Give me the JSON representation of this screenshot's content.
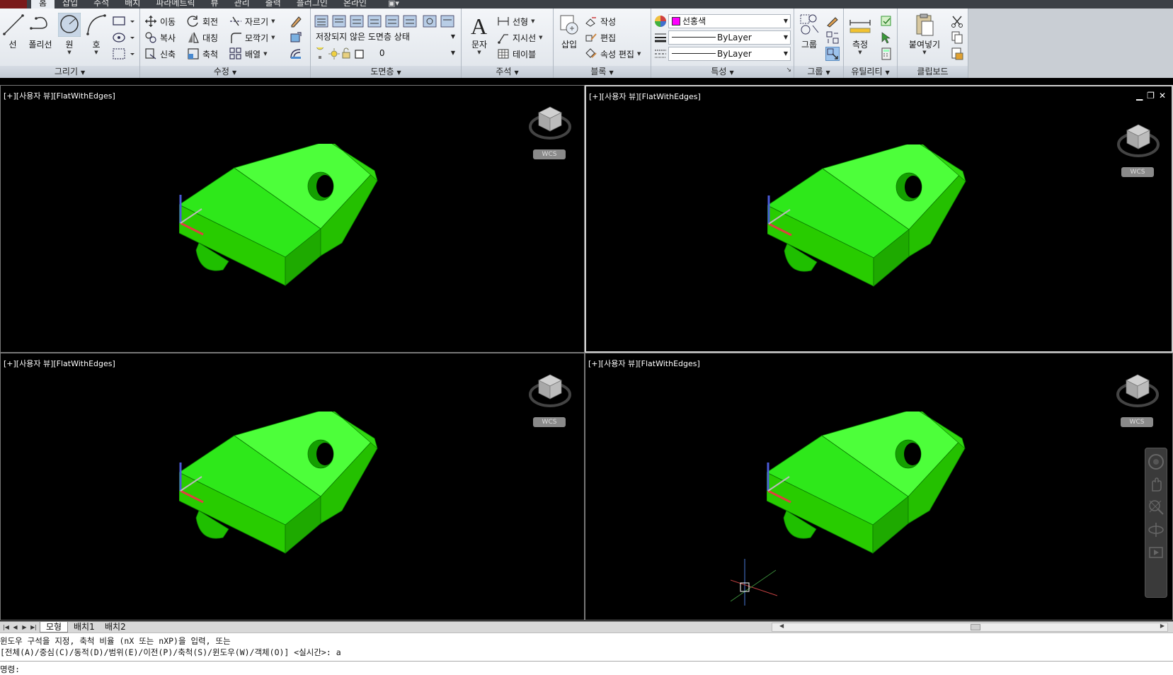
{
  "menu": {
    "tabs": [
      "홈",
      "삽입",
      "주석",
      "배치",
      "파라메트릭",
      "뷰",
      "관리",
      "출력",
      "플러그인",
      "온라인"
    ],
    "active_tab": "홈"
  },
  "ribbon": {
    "draw": {
      "footer": "그리기",
      "line": "선",
      "polyline": "폴리선",
      "circle": "원",
      "arc": "호"
    },
    "modify": {
      "footer": "수정",
      "move": "이동",
      "rotate": "회전",
      "trim": "자르기",
      "copy": "복사",
      "mirror": "대칭",
      "fillet": "모깍기",
      "stretch": "신축",
      "scale": "축척",
      "array": "배열"
    },
    "layers": {
      "footer": "도면층",
      "state": "저장되지 않은 도면층 상태",
      "current_layer": "0"
    },
    "annotation": {
      "footer": "주석",
      "text": "문자",
      "linear": "선형",
      "leader": "지시선",
      "table": "테이블"
    },
    "block": {
      "footer": "블록",
      "insert": "삽입",
      "create": "작성",
      "edit": "편집",
      "edit_attributes": "속성 편집"
    },
    "properties": {
      "footer": "특성",
      "color": "선홍색",
      "color_hex": "#ff00ff",
      "lineweight": "ByLayer",
      "linetype": "ByLayer"
    },
    "groups": {
      "footer": "그룹",
      "group": "그룹"
    },
    "utilities": {
      "footer": "유틸리티",
      "measure": "측정"
    },
    "clipboard": {
      "footer": "클립보드",
      "paste": "붙여넣기"
    }
  },
  "viewports": [
    {
      "label": "[+][사용자 뷰][FlatWithEdges]",
      "wcs": "WCS",
      "active": false
    },
    {
      "label": "[+][사용자 뷰][FlatWithEdges]",
      "wcs": "WCS",
      "active": true
    },
    {
      "label": "[+][사용자 뷰][FlatWithEdges]",
      "wcs": "WCS",
      "active": false
    },
    {
      "label": "[+][사용자 뷰][FlatWithEdges]",
      "wcs": "WCS",
      "active": false
    }
  ],
  "model_color": "#22dd00",
  "layout_tabs": [
    "모형",
    "배치1",
    "배치2"
  ],
  "active_layout": "모형",
  "command_line": {
    "line1": "윈도우 구석을 지정, 축척 비율 (nX 또는 nXP)을 입력, 또는",
    "line2": "[전체(A)/중심(C)/동적(D)/범위(E)/이전(P)/축척(S)/윈도우(W)/객체(O)] <실시간>: a",
    "prompt": "명령:"
  }
}
